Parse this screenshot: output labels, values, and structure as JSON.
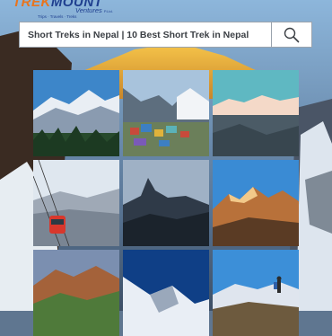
{
  "logo": {
    "brand_part1": "TREK",
    "brand_part2": "MOUNT",
    "subtitle": "Ventures",
    "subtitle_suffix": "P.Ltd.",
    "tagline": "Trips · Travels · Treks"
  },
  "search": {
    "value": "Short Treks in Nepal | 10 Best Short Trek in Nepal",
    "icon": "search-icon"
  },
  "gallery": {
    "tiles": [
      {
        "name": "gallery-image-1",
        "scene": "snowy-peaks-forest"
      },
      {
        "name": "gallery-image-2",
        "scene": "mountain-village"
      },
      {
        "name": "gallery-image-3",
        "scene": "sunrise-peaks-teal-sky"
      },
      {
        "name": "gallery-image-4",
        "scene": "cable-car-valley"
      },
      {
        "name": "gallery-image-5",
        "scene": "fishtail-peak-silhouette"
      },
      {
        "name": "gallery-image-6",
        "scene": "golden-peaks-blue-sky"
      },
      {
        "name": "gallery-image-7",
        "scene": "green-hills-dusk"
      },
      {
        "name": "gallery-image-8",
        "scene": "snow-ridge-night"
      },
      {
        "name": "gallery-image-9",
        "scene": "hiker-on-ridge"
      }
    ]
  },
  "colors": {
    "brand_orange": "#e8741e",
    "brand_blue": "#1f3f8f",
    "search_text": "#3b3f44",
    "search_border": "#9aa3ad"
  }
}
